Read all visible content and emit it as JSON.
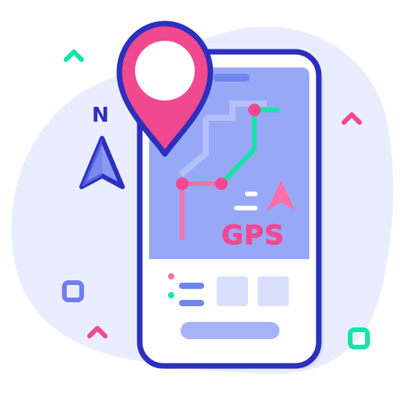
{
  "illustration": {
    "gps_label": "GPS",
    "north_label": "N",
    "colors": {
      "outline": "#2d2fbd",
      "pin": "#f1498f",
      "route_green": "#18e3a8",
      "route_pink": "#ff6fa9",
      "screen": "#97a8f7",
      "panel": "#ffffff",
      "blob": "#e8ecff",
      "accent_green": "#18e3a8",
      "accent_pink": "#f1498f",
      "accent_blue": "#6f7ef0"
    },
    "icons": [
      "map-pin-icon",
      "north-arrow-icon",
      "navigation-arrow-icon",
      "phone-icon"
    ]
  }
}
